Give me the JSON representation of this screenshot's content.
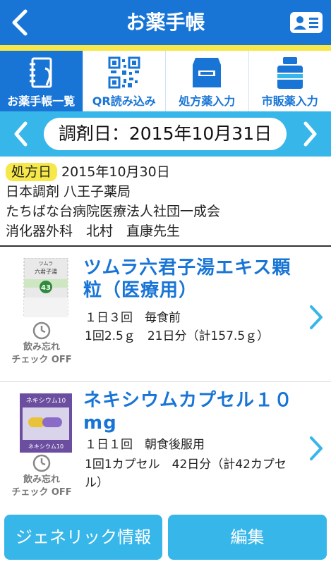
{
  "header": {
    "title": "お薬手帳"
  },
  "tabs": [
    {
      "label": "お薬手帳一覧",
      "icon": "notebook-icon",
      "active": true
    },
    {
      "label": "QR読み込み",
      "icon": "qr-code-icon",
      "active": false
    },
    {
      "label": "処方薬入力",
      "icon": "prescription-bag-icon",
      "active": false
    },
    {
      "label": "市販薬入力",
      "icon": "medicine-bottle-icon",
      "active": false
    }
  ],
  "date_nav": {
    "label": "調剤日：2015年10月31日"
  },
  "prescription": {
    "badge": "処方日",
    "date": "2015年10月30日",
    "pharmacy": "日本調剤 八王子薬局",
    "hospital": "たちばな台病院医療法人社団一成会",
    "doctor": "消化器外科　北村　直康先生"
  },
  "medicines": [
    {
      "name": "ツムラ六君子湯エキス顆粒（医療用）",
      "line1": "１日３回　毎食前",
      "line2": "1回2.5ｇ　21日分（計157.5ｇ）",
      "image_text_top": "ツムラ",
      "image_text_mid": "六君子湯",
      "image_number": "43",
      "reminder_line1": "飲み忘れ",
      "reminder_line2": "チェック OFF"
    },
    {
      "name": "ネキシウムカプセル１０mg",
      "line1": "１日１回　朝食後服用",
      "line2": "1回1カプセル　42日分（計42カプセル）",
      "image_text_top": "ネキシウム10",
      "image_text_bottom": "ネキシウム10",
      "reminder_line1": "飲み忘れ",
      "reminder_line2": "チェック OFF"
    }
  ],
  "buttons": {
    "generic": "ジェネリック情報",
    "edit": "編集"
  },
  "colors": {
    "primary": "#1875d6",
    "accent": "#f7e84a",
    "secondary": "#37b6ea"
  }
}
